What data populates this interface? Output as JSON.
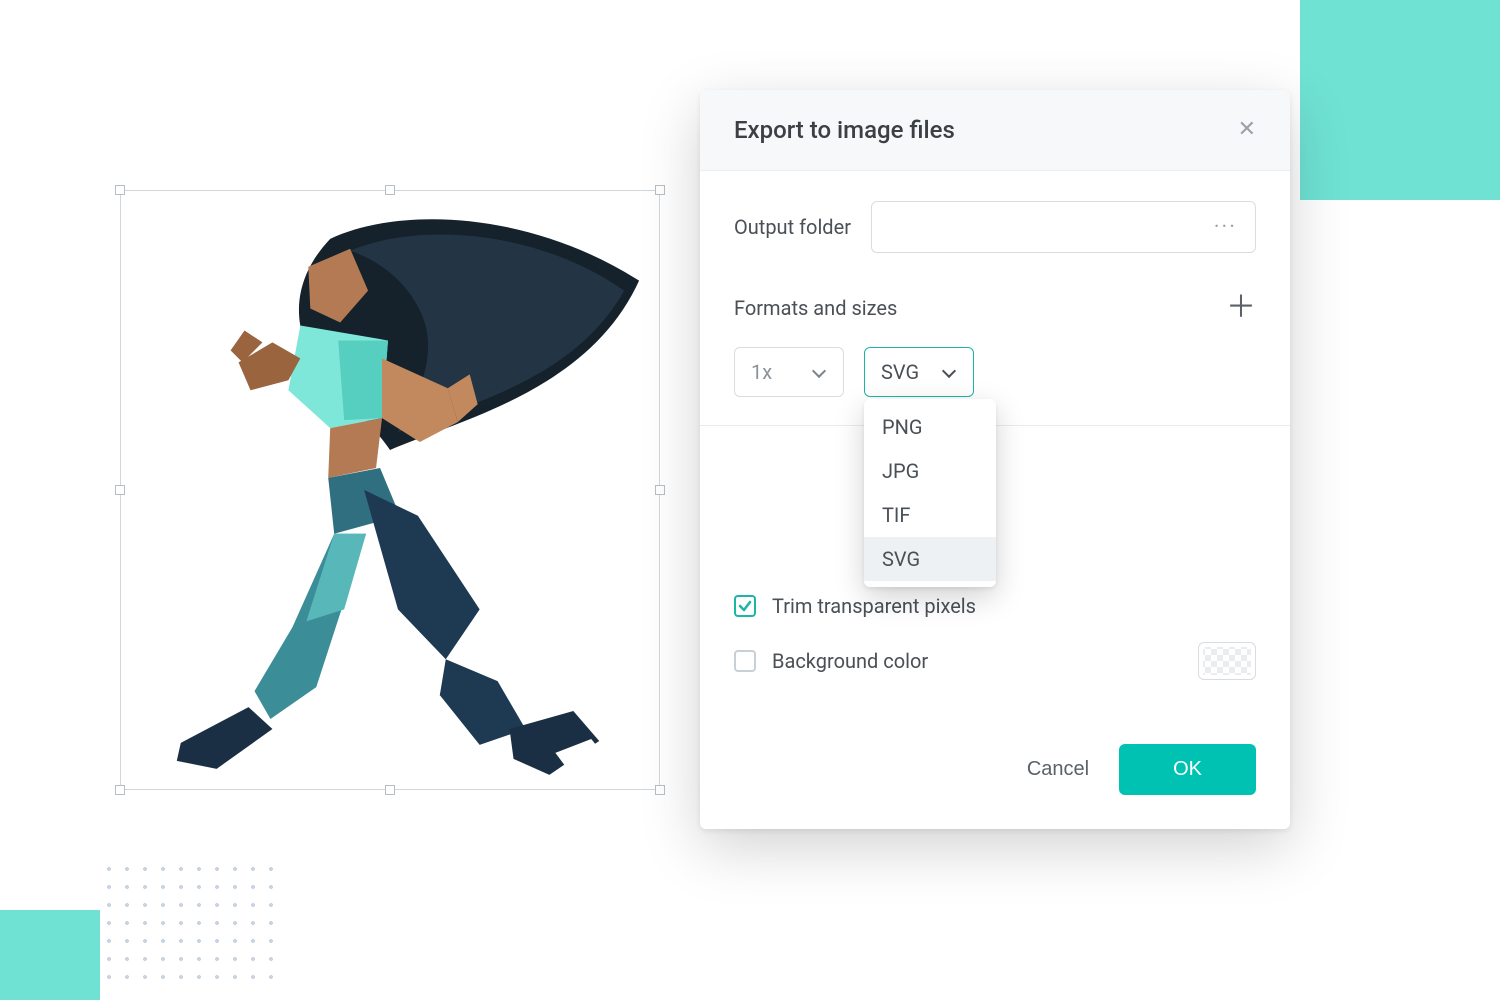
{
  "dialog": {
    "title": "Export to image files",
    "output_folder_label": "Output folder",
    "output_folder_value": "",
    "browse_ellipsis": "···",
    "formats_label": "Formats and sizes",
    "scale_value": "1x",
    "format_value": "SVG",
    "format_options": [
      "PNG",
      "JPG",
      "TIF",
      "SVG"
    ],
    "format_selected_index": 3,
    "trim_label": "Trim transparent pixels",
    "trim_checked": true,
    "bg_label": "Background color",
    "bg_checked": false,
    "cancel": "Cancel",
    "ok": "OK"
  },
  "colors": {
    "accent": "#00c2b2"
  }
}
